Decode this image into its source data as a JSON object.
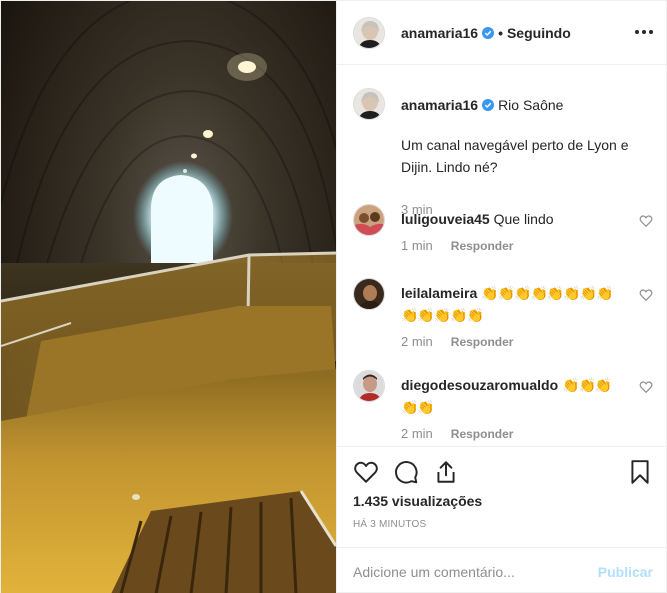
{
  "colors": {
    "text": "#262626",
    "muted": "#8e8e8e",
    "border": "#efefef",
    "verified": "#3897f0",
    "publish_disabled": "#b2dffc"
  },
  "header": {
    "username": "anamaria16",
    "verified_icon": "verified-badge-icon",
    "separator": "•",
    "follow_status": "Seguindo",
    "more_icon": "more-options-icon"
  },
  "caption": {
    "username": "anamaria16",
    "location": "Rio Saône",
    "text": "Um canal navegável perto de Lyon e Dijin. Lindo né?",
    "time": "3 min"
  },
  "comments": [
    {
      "username": "luligouveia45",
      "text": "Que lindo",
      "time": "1 min",
      "reply": "Responder"
    },
    {
      "username": "leilalameira",
      "text": "👏👏👏👏👏👏👏👏👏👏👏👏👏",
      "time": "2 min",
      "reply": "Responder"
    },
    {
      "username": "diegodesouzaromualdo",
      "text": "👏👏👏👏👏",
      "time": "2 min",
      "reply": "Responder"
    }
  ],
  "actions": {
    "like_icon": "heart-icon",
    "comment_icon": "comment-bubble-icon",
    "share_icon": "share-icon",
    "save_icon": "bookmark-icon",
    "views": "1.435 visualizações",
    "posted_ago": "HÁ 3 MINUTOS"
  },
  "add_comment": {
    "placeholder": "Adicione um comentário...",
    "publish": "Publicar"
  }
}
